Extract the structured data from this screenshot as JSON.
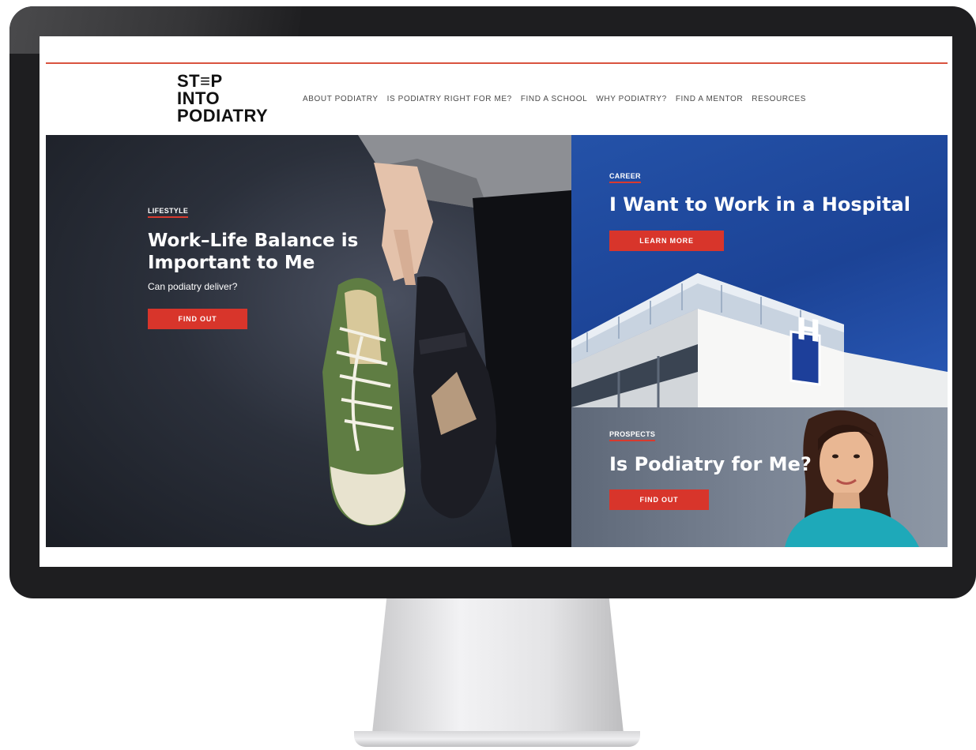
{
  "site": {
    "logo_lines": [
      "ST≡P",
      "INTO",
      "PODIATRY"
    ],
    "accent_color": "#d8352b",
    "nav": [
      "ABOUT PODIATRY",
      "IS PODIATRY RIGHT FOR ME?",
      "FIND A SCHOOL",
      "WHY PODIATRY?",
      "FIND A MENTOR",
      "RESOURCES"
    ]
  },
  "hero": {
    "lifestyle": {
      "kicker": "LIFESTYLE",
      "headline_line1": "Work–Life Balance is",
      "headline_line2": "Important to Me",
      "subline": "Can podiatry deliver?",
      "cta": "FIND OUT",
      "image_icon": "shoes-icon"
    },
    "career": {
      "kicker": "CAREER",
      "headline": "I Want to Work in a Hospital",
      "cta": "LEARN MORE",
      "image_icon": "hospital-icon",
      "sign_letter": "H"
    },
    "prospects": {
      "kicker": "PROSPECTS",
      "headline": "Is Podiatry for Me?",
      "cta": "FIND OUT",
      "image_icon": "person-icon"
    }
  }
}
